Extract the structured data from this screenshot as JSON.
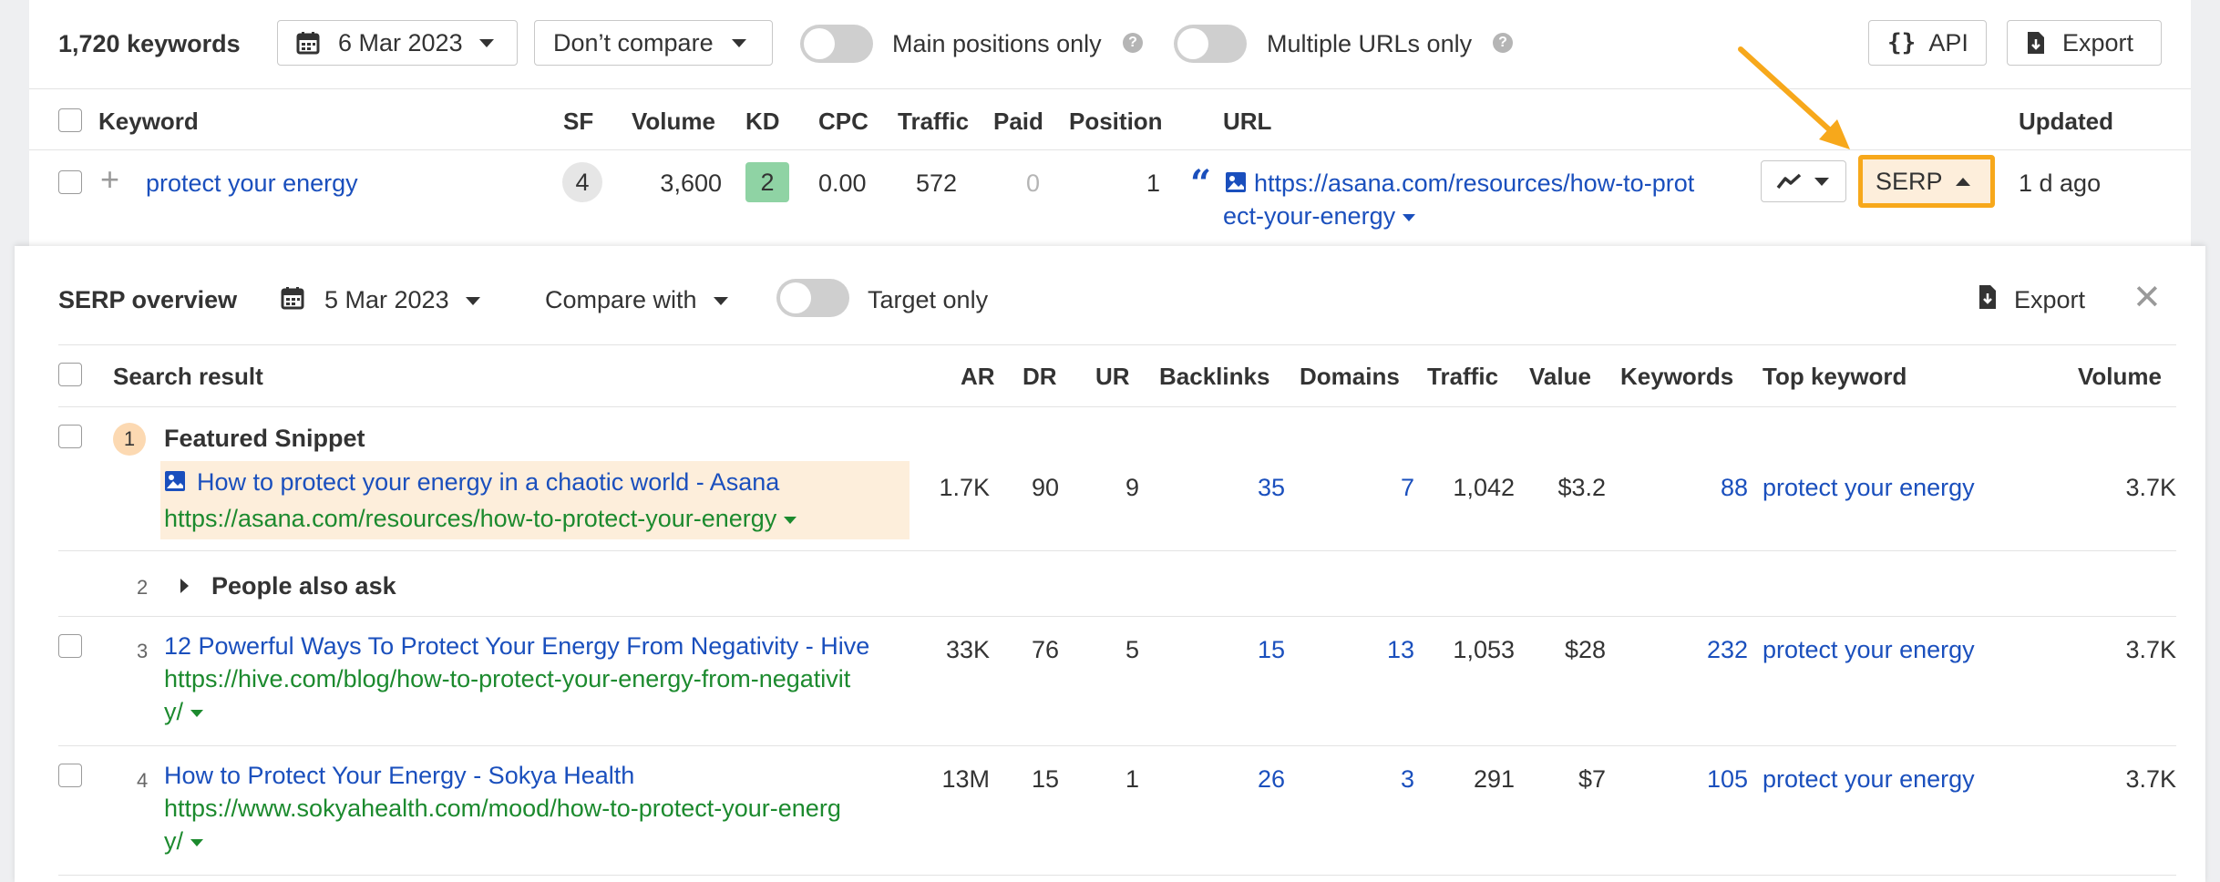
{
  "toolbar": {
    "keyword_count": "1,720 keywords",
    "date": "6 Mar 2023",
    "compare": "Don’t compare",
    "main_positions": "Main positions only",
    "multiple_urls": "Multiple URLs only",
    "api": "API",
    "export": "Export",
    "help": "?"
  },
  "table": {
    "headers": {
      "keyword": "Keyword",
      "sf": "SF",
      "volume": "Volume",
      "kd": "KD",
      "cpc": "CPC",
      "traffic": "Traffic",
      "paid": "Paid",
      "position": "Position",
      "url": "URL",
      "updated": "Updated"
    },
    "row": {
      "keyword": "protect your energy",
      "sf": "4",
      "volume": "3,600",
      "kd": "2",
      "cpc": "0.00",
      "traffic": "572",
      "paid": "0",
      "position": "1",
      "url_line1": "https://asana.com/resources/how-to-prot",
      "url_line2": "ect-your-energy",
      "serp_button": "SERP",
      "updated": "1 d ago"
    }
  },
  "serp": {
    "title": "SERP overview",
    "date": "5 Mar 2023",
    "compare": "Compare with",
    "target_only": "Target only",
    "export": "Export",
    "headers": {
      "result": "Search result",
      "ar": "AR",
      "dr": "DR",
      "ur": "UR",
      "backlinks": "Backlinks",
      "domains": "Domains",
      "traffic": "Traffic",
      "value": "Value",
      "keywords": "Keywords",
      "top_keyword": "Top keyword",
      "volume": "Volume"
    },
    "results": [
      {
        "pos": "1",
        "label": "Featured Snippet",
        "title": "How to protect your energy in a chaotic world - Asana",
        "url": "https://asana.com/resources/how-to-protect-your-energy",
        "ar": "1.7K",
        "dr": "90",
        "ur": "9",
        "backlinks": "35",
        "domains": "7",
        "traffic": "1,042",
        "value": "$3.2",
        "keywords": "88",
        "top_keyword": "protect your energy",
        "volume": "3.7K"
      },
      {
        "pos": "2",
        "label": "People also ask"
      },
      {
        "pos": "3",
        "title": "12 Powerful Ways To Protect Your Energy From Negativity - Hive",
        "url_line1": "https://hive.com/blog/how-to-protect-your-energy-from-negativit",
        "url_line2": "y/",
        "ar": "33K",
        "dr": "76",
        "ur": "5",
        "backlinks": "15",
        "domains": "13",
        "traffic": "1,053",
        "value": "$28",
        "keywords": "232",
        "top_keyword": "protect your energy",
        "volume": "3.7K"
      },
      {
        "pos": "4",
        "title": "How to Protect Your Energy - Sokya Health",
        "url_line1": "https://www.sokyahealth.com/mood/how-to-protect-your-energ",
        "url_line2": "y/",
        "ar": "13M",
        "dr": "15",
        "ur": "1",
        "backlinks": "26",
        "domains": "3",
        "traffic": "291",
        "value": "$7",
        "keywords": "105",
        "top_keyword": "protect your energy",
        "volume": "3.7K"
      }
    ]
  },
  "colors": {
    "link": "#1a4fbd",
    "url_green": "#1c8a2e",
    "kd_badge": "#8fd3a4",
    "highlight": "#fdeedb",
    "annotation": "#f7a81b"
  }
}
